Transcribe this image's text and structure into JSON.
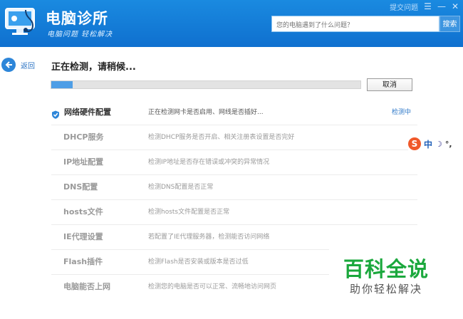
{
  "header": {
    "title": "电脑诊所",
    "slogan": "电脑问题 轻松解决",
    "top_link": "提交问题",
    "menu_glyph": "☰",
    "minimize_glyph": "—",
    "close_glyph": "✕",
    "search_placeholder": "您的电脑遇到了什么问题？",
    "search_label": "搜索"
  },
  "nav": {
    "back_label": "返回"
  },
  "scan": {
    "title": "正在检测，请稍候...",
    "progress": 0.07,
    "cancel_label": "取消"
  },
  "checks": [
    {
      "name": "网络硬件配置",
      "desc": "正在检测网卡是否启用、网线是否插好...",
      "status": "检测中",
      "active": true
    },
    {
      "name": "DHCP服务",
      "desc": "检测DHCP服务是否开启、相关注册表设置是否完好"
    },
    {
      "name": "IP地址配置",
      "desc": "检测IP地址是否存在错误或冲突的异常情况"
    },
    {
      "name": "DNS配置",
      "desc": "检测DNS配置是否正常"
    },
    {
      "name": "hosts文件",
      "desc": "检测hosts文件配置是否正常"
    },
    {
      "name": "IE代理设置",
      "desc": "若配置了IE代理服务器，检测能否访问网络"
    },
    {
      "name": "Flash插件",
      "desc": "检测Flash是否安装或版本是否过低"
    },
    {
      "name": "电脑能否上网",
      "desc": "检测您的电脑是否可以正常、流畅地访问网页"
    }
  ],
  "ime": {
    "logo": "S",
    "mode": "中",
    "moon": "☽",
    "punct": "°,"
  },
  "watermark": {
    "title": "百科全说",
    "subtitle": "助你轻松解决"
  },
  "colors": {
    "header": "#1585dc",
    "accent": "#2d86d9",
    "progress_fill": "#4e9ee6",
    "watermark_green": "#1ba83d"
  }
}
